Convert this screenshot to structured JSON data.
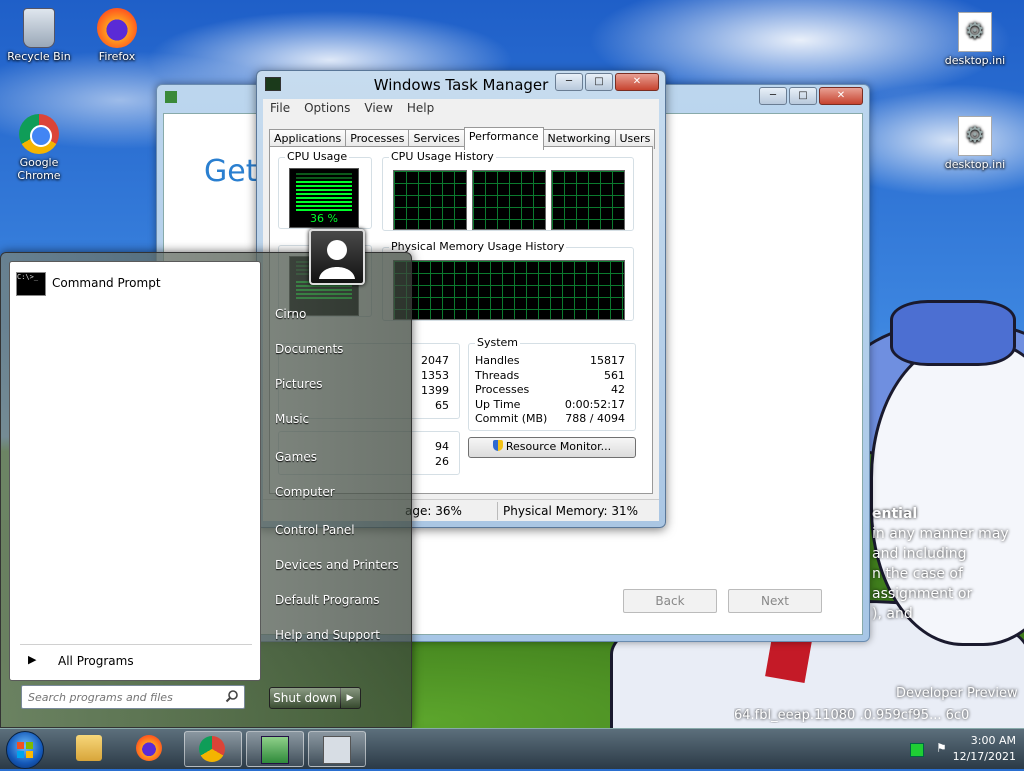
{
  "desktop": {
    "icons": {
      "recycle_bin": "Recycle Bin",
      "firefox": "Firefox",
      "chrome": "Google Chrome",
      "desktop_ini_1": "desktop.ini",
      "desktop_ini_2": "desktop.ini"
    },
    "wallpaper_text": {
      "heading": "ential",
      "line1": "in any manner may",
      "line2": "and including",
      "line3": "n the case of",
      "line4": "assignment or",
      "line5": "), and",
      "build_line1": "Developer Preview",
      "build_line2": "64.fbl_eeap.11080 .0.959cf95... 6c0"
    }
  },
  "setup_window": {
    "heading": "Gett",
    "back_label": "Back",
    "next_label": "Next"
  },
  "task_manager": {
    "title": "Windows Task Manager",
    "menu": [
      "File",
      "Options",
      "View",
      "Help"
    ],
    "tabs": [
      "Applications",
      "Processes",
      "Services",
      "Performance",
      "Networking",
      "Users"
    ],
    "active_tab": "Performance",
    "cpu_usage_title": "CPU Usage",
    "cpu_usage_value": "36 %",
    "cpu_history_title": "CPU Usage History",
    "memory_history_title": "Physical Memory Usage History",
    "physical_memory_values": [
      "2047",
      "1353",
      "1399",
      "65"
    ],
    "kernel_memory_values": [
      "94",
      "26"
    ],
    "system": {
      "title": "System",
      "rows": [
        {
          "label": "Handles",
          "value": "15817"
        },
        {
          "label": "Threads",
          "value": "561"
        },
        {
          "label": "Processes",
          "value": "42"
        },
        {
          "label": "Up Time",
          "value": "0:00:52:17"
        },
        {
          "label": "Commit (MB)",
          "value": "788 / 4094"
        }
      ]
    },
    "resource_monitor_label": "Resource Monitor...",
    "status": {
      "cpu": "age: 36%",
      "memory": "Physical Memory: 31%"
    },
    "caption": {
      "minimize": "─",
      "maximize": "□",
      "close": "✕"
    }
  },
  "start_menu": {
    "programs": [
      {
        "label": "Command Prompt"
      }
    ],
    "all_programs_label": "All Programs",
    "search_placeholder": "Search programs and files",
    "right_links": [
      "Cirno",
      "Documents",
      "Pictures",
      "Music",
      "Games",
      "Computer",
      "Control Panel",
      "Devices and Printers",
      "Default Programs",
      "Help and Support"
    ],
    "shutdown_label": "Shut down"
  },
  "taskbar": {
    "clock_time": "3:00 AM",
    "clock_date": "12/17/2021"
  },
  "colors": {
    "accent_heading": "#2a7fd0",
    "meter_green": "#00ff2a"
  }
}
